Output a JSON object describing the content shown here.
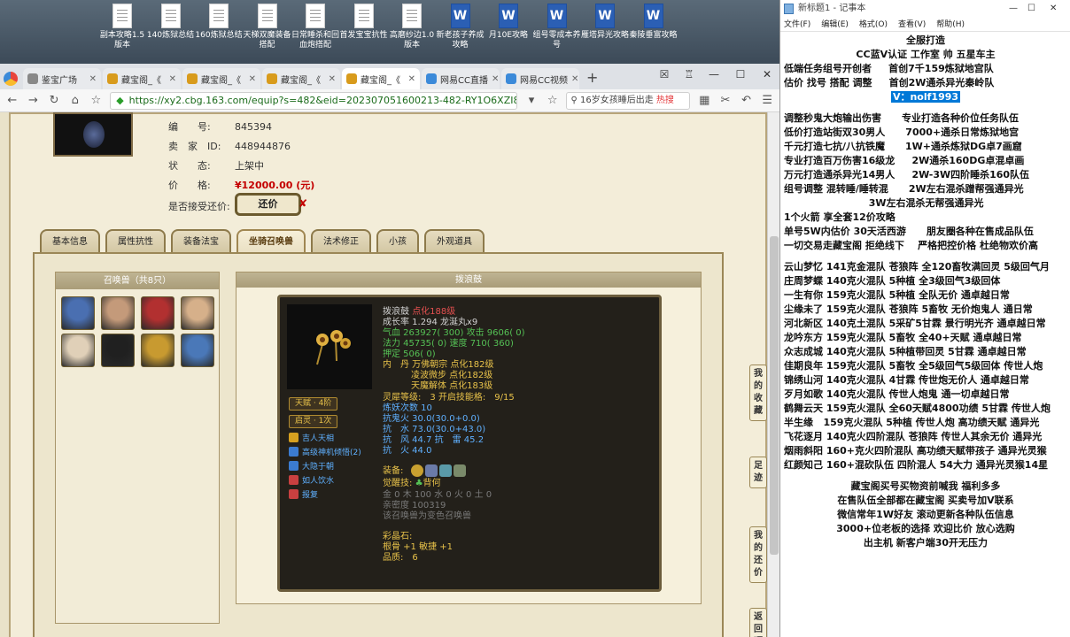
{
  "desktop_icons": [
    {
      "label": "副本攻略1.5版本",
      "type": "txt"
    },
    {
      "label": "140炼狱总结",
      "type": "txt"
    },
    {
      "label": "160炼狱总结",
      "type": "txt"
    },
    {
      "label": "天梯双魔装备搭配",
      "type": "txt"
    },
    {
      "label": "日常睡杀和回血炮搭配",
      "type": "txt"
    },
    {
      "label": "首发宝宝抗性",
      "type": "txt"
    },
    {
      "label": "高磨纱边1.0版本",
      "type": "txt"
    },
    {
      "label": "新老孩子养成攻略",
      "type": "word"
    },
    {
      "label": "月10E攻略",
      "type": "word"
    },
    {
      "label": "组号零成本养号",
      "type": "word"
    },
    {
      "label": "雁塔异光攻略",
      "type": "word"
    },
    {
      "label": "秦陵垂富攻略",
      "type": "word"
    }
  ],
  "browser": {
    "tabs": [
      {
        "label": "鉴宝广场",
        "active": false
      },
      {
        "label": "藏宝阁_《",
        "active": false
      },
      {
        "label": "藏宝阁_《",
        "active": false
      },
      {
        "label": "藏宝阁_《",
        "active": false
      },
      {
        "label": "藏宝阁_《",
        "active": true
      },
      {
        "label": "网易CC直播",
        "active": false
      },
      {
        "label": "网易CC视频",
        "active": false
      }
    ],
    "url": "https://xy2.cbg.163.com/equip?s=482&eid=202307051600213-482-RY1O6XZI8GXKS",
    "search_text": "16岁女孩睡后出走",
    "search_hot": "热搜"
  },
  "item": {
    "id_label": "编　　号:",
    "id_value": "845394",
    "seller_label": "卖　家　ID:",
    "seller_value": "448944876",
    "status_label": "状　　态:",
    "status_value": "上架中",
    "price_label": "价　　格:",
    "price_value": "¥12000.00 (元)",
    "counter_label": "是否接受还价:",
    "counter_button": "还价"
  },
  "page_tabs": [
    "基本信息",
    "属性抗性",
    "装备法宝",
    "坐骑召唤兽",
    "法术修正",
    "小孩",
    "外观道具"
  ],
  "active_page_tab": 3,
  "pets": {
    "header": "召唤兽（共8只）",
    "colors": [
      "#4a6fb1",
      "#c49a7a",
      "#b23030",
      "#d6b08a",
      "#e0d0b8",
      "#202020",
      "#c89a30",
      "#4a78b8"
    ]
  },
  "detail": {
    "header": "拨浪鼓",
    "name": "拨浪鼓",
    "level": "点化188级",
    "growth": "成长率 1.294 龙涎丸x9",
    "hp": "气血 263927( 300) 攻击 9606( 0)",
    "mp": "法力 45735( 0) 速度 710( 360)",
    "def": "押定 506( 0)",
    "inner1": "内　丹 万佛朝宗 点化182级",
    "inner2": "凌波微步 点化182级",
    "inner3": "天魔解体 点化183级",
    "spirit": "灵犀等级:　3 开启技能格:　9/15",
    "refine": "炼妖次数 10",
    "res1": "抗鬼火 30.0(30.0+0.0)",
    "res2": "抗　水 73.0(30.0+43.0)",
    "res3": "抗　风 44.7 抗　雷 45.2",
    "res4": "抗　火 44.0",
    "talent": "天赋 · 4阶",
    "qiling": "启灵 · 1次",
    "skills": [
      "吉人天相",
      "高级神机倾悟(2)",
      "大隐于朝",
      "如人饮水",
      "报复"
    ],
    "skill_colors": [
      "#d6a020",
      "#3b7bd0",
      "#3b7bd0",
      "#c84040",
      "#c84040"
    ],
    "equip_label": "装备:",
    "awaken_label": "觉醒技:",
    "awaken_value": "背何",
    "elements": "金 0 木 100 水 0 火 0 土 0",
    "affection": "亲密度 100319",
    "transform": "该召唤兽为变色召唤兽",
    "stone_label": "彩晶石:",
    "stone_value": "根骨 +1 敏捷 +1",
    "quality": "品质:　6"
  },
  "side_links": [
    "我的收藏",
    "足迹",
    "我的还价",
    "返回顶部"
  ],
  "notepad": {
    "title": "新标题1 - 记事本",
    "menu": [
      "文件(F)",
      "编辑(E)",
      "格式(O)",
      "查看(V)",
      "帮助(H)"
    ],
    "lines": [
      {
        "text": "全服打造",
        "align": "center"
      },
      {
        "text": "CC蓝V认证 工作室 帅 五星车主",
        "align": "center"
      },
      {
        "text": "低端任务组号开创者     首创7千159炼狱地宫队",
        "align": "left"
      },
      {
        "text": "估价 找号 搭配 调整     首创2W通杀异光秦岭队",
        "align": "left"
      },
      {
        "text": "V：nolf1993",
        "align": "center",
        "highlight": true
      },
      {
        "text": "",
        "align": "left"
      },
      {
        "text": "调整秒鬼大炮输出伤害      专业打造各种价位任务队伍",
        "align": "left"
      },
      {
        "text": "低价打造站街双30男人      7000+通杀日常炼狱地宫",
        "align": "left"
      },
      {
        "text": "千元打造七抗/八抗铁魔      1W+通杀炼狱DG卓7画窟",
        "align": "left"
      },
      {
        "text": "专业打造百万伤害16级龙     2W通杀160DG卓混卓画",
        "align": "left"
      },
      {
        "text": "万元打造通杀异光14男人     2W-3W四阶睡杀160队伍",
        "align": "left"
      },
      {
        "text": "组号调整 混转睡/睡转混      2W左右混杀蹭帮强通异光",
        "align": "left"
      },
      {
        "text": "                         3W左右混杀无帮强通异光",
        "align": "left"
      },
      {
        "text": "1个火箭 享全套12价攻略",
        "align": "left"
      },
      {
        "text": "单号5W内估价 30天活西游      朋友圈各种在售成品队伍",
        "align": "left"
      },
      {
        "text": "一切交易走藏宝阁 拒绝线下    严格把控价格 杜绝物欢价高",
        "align": "left"
      },
      {
        "text": "",
        "align": "left"
      },
      {
        "text": "云山梦忆 141克金混队 苍狼阵 全120畜牧满回灵 5级回气月",
        "align": "left"
      },
      {
        "text": "庄周梦蝶 140克火混队 5种植 全3级回气3级回体",
        "align": "left"
      },
      {
        "text": "一生有你 159克火混队 5种植 全队无价 通卓越日常",
        "align": "left"
      },
      {
        "text": "尘缘未了 159克火混队 苍狼阵 5畜牧 无价炮鬼人 通日常",
        "align": "left"
      },
      {
        "text": "河北新区 140克土混队 5采矿5甘霖 景行明光齐 通卓越日常",
        "align": "left"
      },
      {
        "text": "龙吟东方 159克火混队 5畜牧 全40+天赋 通卓越日常",
        "align": "left"
      },
      {
        "text": "众志成城 140克火混队 5种植带回灵 5甘霖 通卓越日常",
        "align": "left"
      },
      {
        "text": "佳期良年 159克火混队 5畜牧 全5级回气5级回体 传世人炮",
        "align": "left"
      },
      {
        "text": "锦绣山河 140克火混队 4甘霖 传世炮无价人 通卓越日常",
        "align": "left"
      },
      {
        "text": "歹月如歌 140克火混队 传世人炮鬼 通一切卓越日常",
        "align": "left"
      },
      {
        "text": "鹤舞云天 159克火混队 全60天赋4800功绩 5甘霖 传世人炮",
        "align": "left"
      },
      {
        "text": "半生缘   159克火混队 5种植 传世人炮 高功绩天赋 通异光",
        "align": "left"
      },
      {
        "text": "飞花逐月 140克火四阶混队 苍狼阵 传世人其余无价 通异光",
        "align": "left"
      },
      {
        "text": "烟雨斜阳 160+克火四阶混队 高功绩天赋带孩子 通异光灵猴",
        "align": "left"
      },
      {
        "text": "红颜知己 160+混砍队伍 四阶混人 54大力 通异光灵猴14星",
        "align": "left"
      },
      {
        "text": "",
        "align": "left"
      },
      {
        "text": "藏宝阁买号买物资前喊我 福利多多",
        "align": "center"
      },
      {
        "text": "在售队伍全部都在藏宝阁 买卖号加V联系",
        "align": "center"
      },
      {
        "text": "微信常年1W好友 滚动更新各种队伍信息",
        "align": "center"
      },
      {
        "text": "3000+位老板的选择 欢迎比价 放心选购",
        "align": "center"
      },
      {
        "text": "出主机 新客户端30开无压力",
        "align": "center"
      }
    ]
  }
}
